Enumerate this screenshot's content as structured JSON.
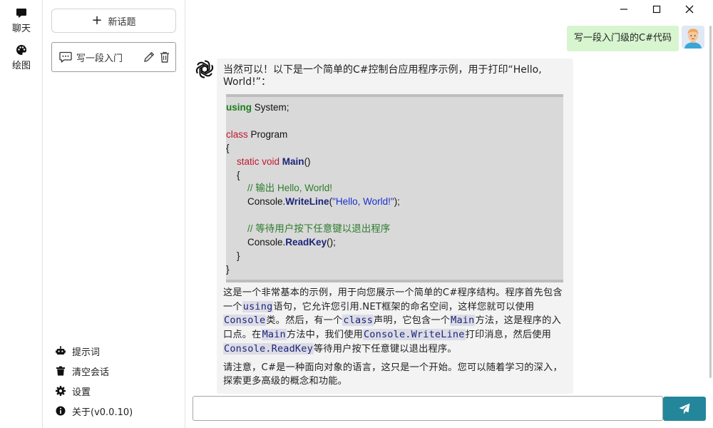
{
  "rail": {
    "items": [
      {
        "label": "聊天",
        "icon": "chat-bubble-icon"
      },
      {
        "label": "绘图",
        "icon": "palette-icon"
      }
    ]
  },
  "sidebar": {
    "new_topic_label": "新话题",
    "conversation_title": "写一段入门",
    "menu": [
      {
        "label": "提示词",
        "icon": "robot-icon"
      },
      {
        "label": "清空会话",
        "icon": "trash-icon"
      },
      {
        "label": "设置",
        "icon": "gear-icon"
      },
      {
        "label": "关于(v0.0.10)",
        "icon": "info-icon"
      }
    ]
  },
  "window_controls": [
    "minimize-icon",
    "maximize-icon",
    "close-icon"
  ],
  "chat": {
    "user_message": "写一段入门级的C#代码",
    "bot": {
      "intro": "当然可以！以下是一个简单的C#控制台应用程序示例，用于打印“Hello, World!”：",
      "code": {
        "l1_kw": "using",
        "l1_rest": " System;",
        "l3_kw": "class",
        "l3_rest": " Program",
        "l4": "{",
        "l5_kw": "static void",
        "l5_name": "Main",
        "l5_rest": "()",
        "l6": "{",
        "l7_comment": "// 输出 Hello, World!",
        "l8_obj": "Console.",
        "l8_method": "WriteLine",
        "l8_open": "(",
        "l8_str": "\"Hello, World!\"",
        "l8_close": ");",
        "l10_comment": "// 等待用户按下任意键以退出程序",
        "l11_obj": "Console.",
        "l11_method": "ReadKey",
        "l11_rest": "();",
        "l12": "}",
        "l13": "}"
      },
      "p1": {
        "t1": "这是一个非常基本的示例，用于向您展示一个简单的C#程序结构。程序首先包含一个",
        "c1": "using",
        "t2": "语句，它允许您引用.NET框架的命名空间，这样您就可以使用",
        "c2": "Console",
        "t3": "类。然后，有一个",
        "c3": "class",
        "t4": "声明，它包含一个",
        "c4": "Main",
        "t5": "方法，这是程序的入口点。在",
        "c5": "Main",
        "t6": "方法中，我们使用",
        "c6": "Console.WriteLine",
        "t7": "打印消息，然后使用",
        "c7": "Console.ReadKey",
        "t8": "等待用户按下任意键以退出程序。"
      },
      "p2": "请注意，C#是一种面向对象的语言，这只是一个开始。您可以随着学习的深入，探索更多高级的概念和功能。"
    }
  },
  "input": {
    "value": "",
    "placeholder": ""
  },
  "send_icon": "send-icon",
  "colors": {
    "user_bubble": "#d7f5cf",
    "bot_bubble": "#f3f3f4",
    "send_button": "#23869b",
    "code_bg": "#d9d9d9"
  }
}
